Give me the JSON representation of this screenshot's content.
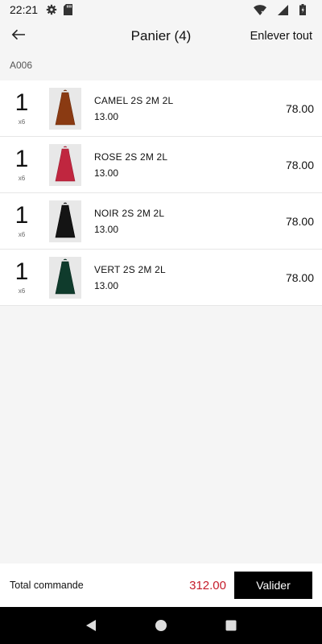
{
  "status_bar": {
    "time": "22:21"
  },
  "header": {
    "title": "Panier (4)",
    "clear_label": "Enlever tout"
  },
  "section": {
    "label": "A006"
  },
  "items": [
    {
      "qty": "1",
      "pack": "x6",
      "name": "CAMEL 2S 2M 2L",
      "unit_price": "13.00",
      "total": "78.00",
      "color": "#8a3a12"
    },
    {
      "qty": "1",
      "pack": "x6",
      "name": "ROSE 2S 2M 2L",
      "unit_price": "13.00",
      "total": "78.00",
      "color": "#c0263f"
    },
    {
      "qty": "1",
      "pack": "x6",
      "name": "NOIR 2S 2M 2L",
      "unit_price": "13.00",
      "total": "78.00",
      "color": "#141414"
    },
    {
      "qty": "1",
      "pack": "x6",
      "name": "VERT 2S 2M 2L",
      "unit_price": "13.00",
      "total": "78.00",
      "color": "#0f3b2c"
    }
  ],
  "footer": {
    "total_label": "Total commande",
    "total_amount": "312.00",
    "validate_label": "Valider"
  },
  "icons": {
    "status": [
      "gear-icon",
      "sd-card-icon",
      "wifi-icon",
      "signal-icon",
      "battery-icon"
    ],
    "nav": [
      "back-triangle-icon",
      "home-circle-icon",
      "recents-square-icon"
    ]
  },
  "colors": {
    "accent_total": "#c51b2a",
    "button_bg": "#000000"
  }
}
